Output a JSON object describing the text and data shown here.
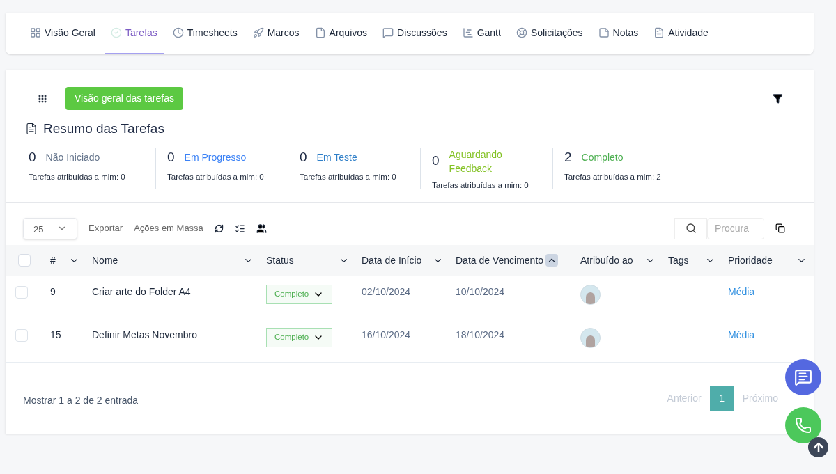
{
  "tabs": [
    {
      "label": "Visão Geral",
      "kind": "grid",
      "selected": false
    },
    {
      "label": "Tarefas",
      "kind": "check",
      "selected": true
    },
    {
      "label": "Timesheets",
      "kind": "clock",
      "selected": false
    },
    {
      "label": "Marcos",
      "kind": "rocket",
      "selected": false
    },
    {
      "label": "Arquivos",
      "kind": "file",
      "selected": false
    },
    {
      "label": "Discussões",
      "kind": "chat",
      "selected": false
    },
    {
      "label": "Gantt",
      "kind": "gantt",
      "selected": false
    },
    {
      "label": "Solicitações",
      "kind": "lifebuoy",
      "selected": false
    },
    {
      "label": "Notas",
      "kind": "note",
      "selected": false
    },
    {
      "label": "Atividade",
      "kind": "doc",
      "selected": false
    }
  ],
  "overview_button": "Visão geral das tarefas",
  "summary": {
    "title": "Resumo das Tarefas",
    "stats": [
      {
        "count": "0",
        "label": "Não Iniciado",
        "color": "#64748b",
        "assigned": "Tarefas atribuídas a mim: 0"
      },
      {
        "count": "0",
        "label": "Em Progresso",
        "color": "#3b82f6",
        "assigned": "Tarefas atribuídas a mim: 0"
      },
      {
        "count": "0",
        "label": "Em Teste",
        "color": "#2f7fc8",
        "assigned": "Tarefas atribuídas a mim: 0"
      },
      {
        "count": "0",
        "label": "Aguardando Feedback",
        "color": "#84c225",
        "assigned": "Tarefas atribuídas a mim: 0"
      },
      {
        "count": "2",
        "label": "Completo",
        "color": "#4caf50",
        "assigned": "Tarefas atribuídas a mim: 2"
      }
    ]
  },
  "toolbar": {
    "page_size": "25",
    "actions": [
      "Exportar",
      "Ações em Massa"
    ],
    "search": {
      "placeholder": "Procura"
    }
  },
  "table": {
    "select_all": {
      "checked": false
    },
    "columns": [
      {
        "label": "#",
        "sorted": false
      },
      {
        "label": "Nome",
        "sorted": false
      },
      {
        "label": "Status",
        "sorted": false
      },
      {
        "label": "Data de Início",
        "sorted": false
      },
      {
        "label": "Data de Vencimento",
        "sorted": true
      },
      {
        "label": "Atribuído ao",
        "sorted": false
      },
      {
        "label": "Tags",
        "sorted": false
      },
      {
        "label": "Prioridade",
        "sorted": false
      }
    ],
    "rows": [
      {
        "checked": false,
        "id": "9",
        "name": "Criar arte do Folder A4",
        "status": "Completo",
        "start": "02/10/2024",
        "due": "10/10/2024",
        "priority": "Média"
      },
      {
        "checked": false,
        "id": "15",
        "name": "Definir Metas Novembro",
        "status": "Completo",
        "start": "16/10/2024",
        "due": "18/10/2024",
        "priority": "Média"
      }
    ]
  },
  "footer": {
    "info": "Mostrar 1 a 2 de 2 entrada",
    "previous": "Anterior",
    "pages": [
      {
        "label": "1",
        "selected": true
      }
    ],
    "next": "Próximo"
  }
}
